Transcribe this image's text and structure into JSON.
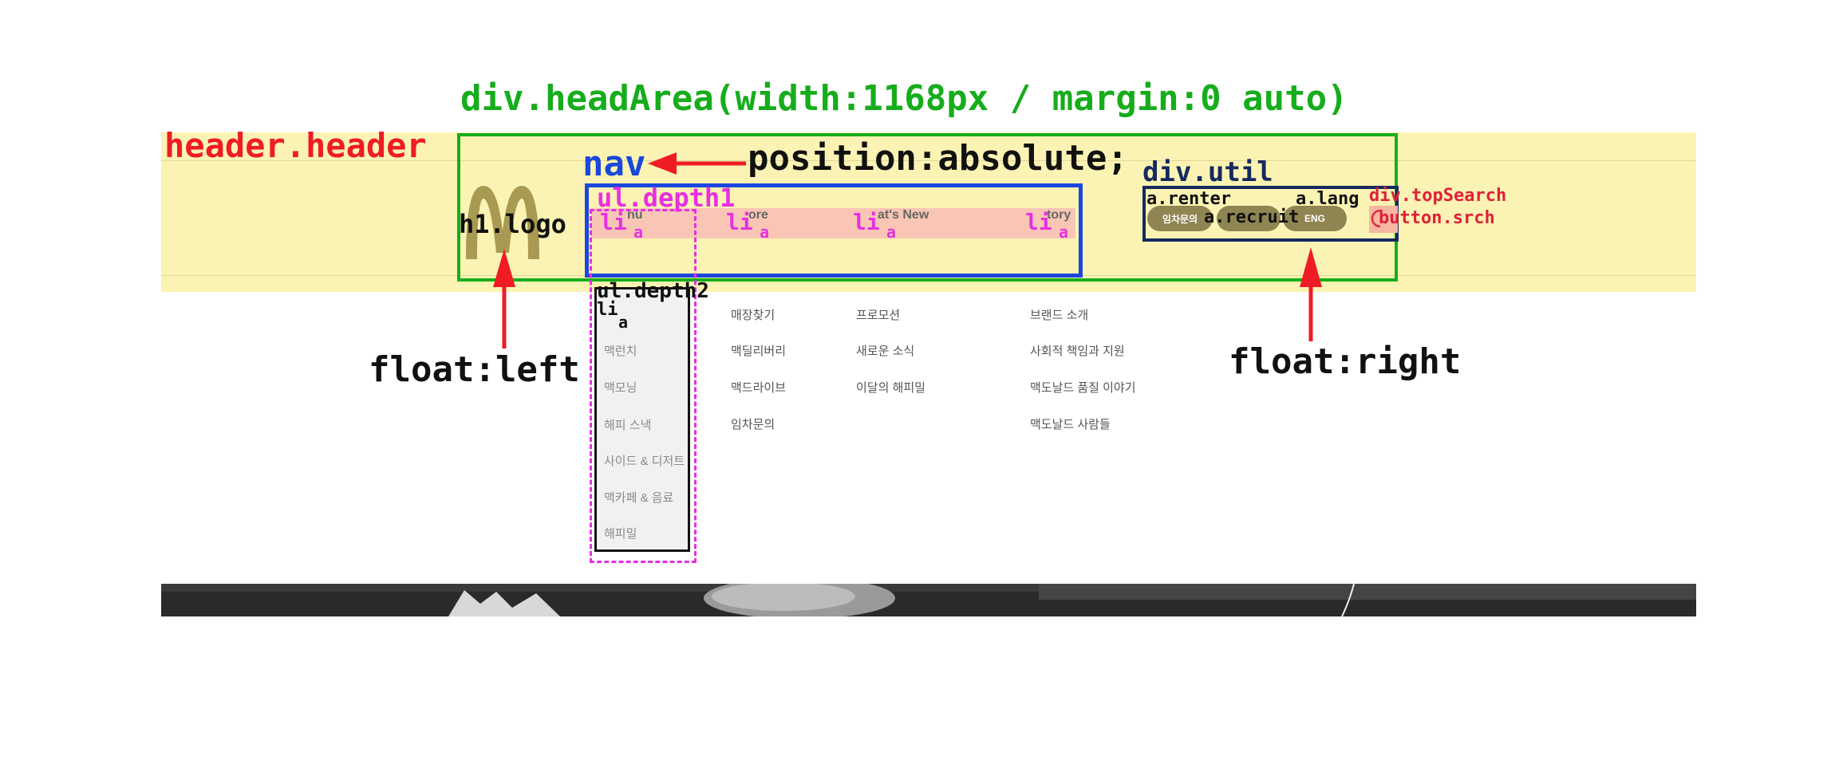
{
  "colors": {
    "header_bg": "#fbf3b3",
    "headarea_border": "#16ad1b",
    "nav_border": "#1a47dc",
    "util_border": "#15285f",
    "depth_label": "#e72fe2",
    "arrow": "#ef1c25",
    "logo": "#a89a52"
  },
  "labels": {
    "headarea": "div.headArea(width:1168px / margin:0 auto)",
    "header": "header.header",
    "nav": "nav",
    "position": "position:absolute;",
    "util": "div.util",
    "depth1": "ul.depth1",
    "logo": "h1.logo",
    "depth2": "ul.depth2",
    "li": "li",
    "a": "a",
    "renter": "a.renter",
    "lang": "a.lang",
    "recruit": "a.recruit",
    "topsearch": "div.topSearch",
    "srch": "button.srch",
    "float_left": "float:left",
    "float_right": "float:right"
  },
  "menu_fragments": [
    "nu",
    "ore",
    "at's New",
    "tory"
  ],
  "util_buttons": {
    "renter": "임차문의",
    "lang": "ENG"
  },
  "depth2_items": [
    "",
    "맥런치",
    "맥모닝",
    "해피 스낵",
    "사이드 & 디저트",
    "맥카페 & 음료",
    "해피밀"
  ],
  "columns": [
    [
      "매장찾기",
      "맥딜리버리",
      "맥드라이브",
      "임차문의"
    ],
    [
      "프로모션",
      "새로운 소식",
      "이달의 해피밀"
    ],
    [
      "브랜드 소개",
      "사회적 책임과 지원",
      "맥도날드 품질 이야기",
      "맥도날드 사람들"
    ]
  ],
  "icons": [
    "mcdonalds-logo-icon",
    "search-icon",
    "arrow-left-icon",
    "arrow-up-icon"
  ]
}
